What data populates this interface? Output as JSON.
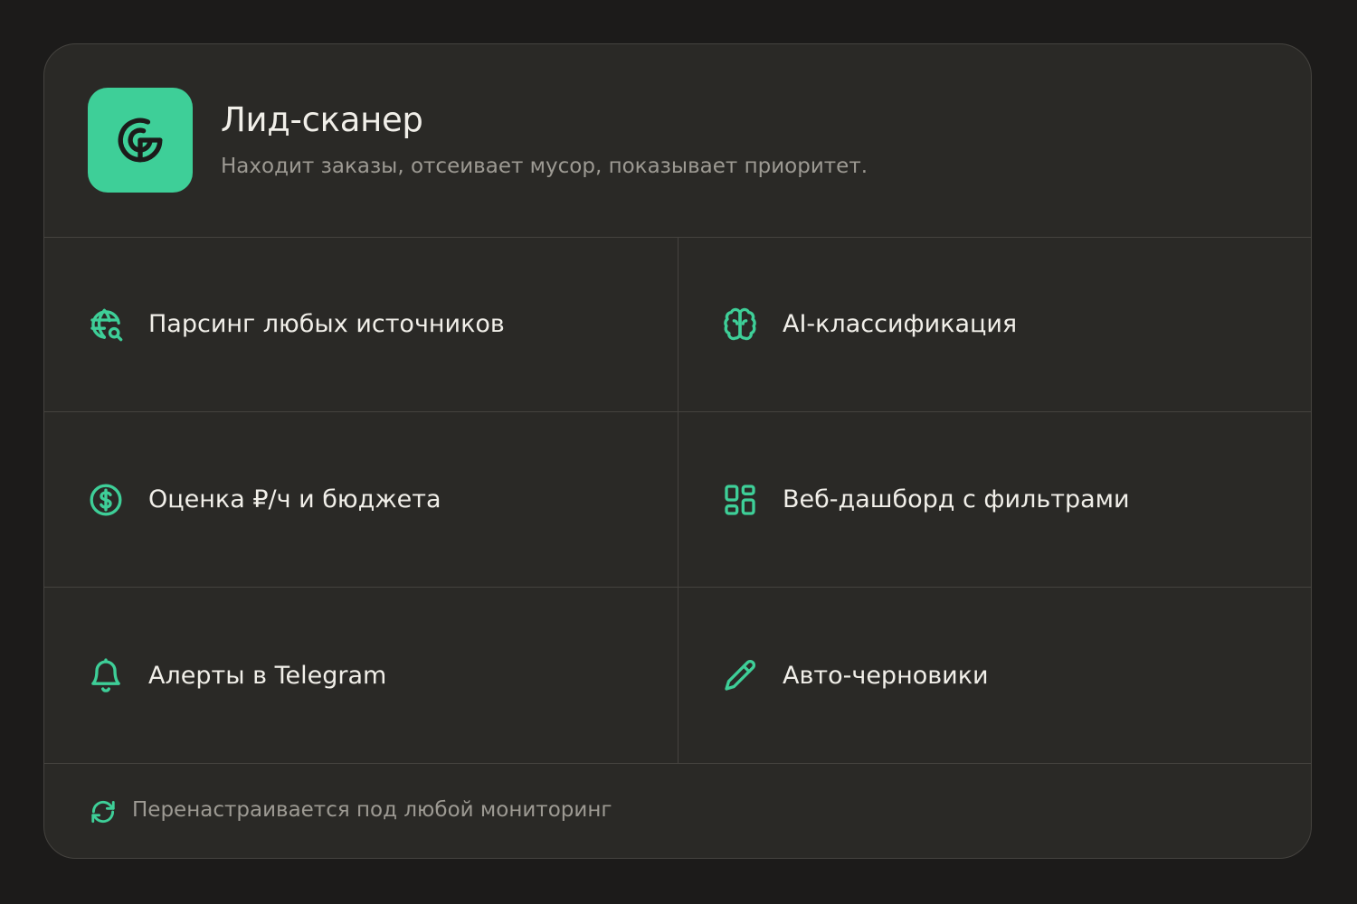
{
  "app": {
    "title": "Лид-сканер",
    "subtitle": "Находит заказы, отсеивает мусор, показывает приоритет.",
    "logo_icon": "radar-scan-icon"
  },
  "features": [
    {
      "label": "Парсинг любых источников",
      "icon": "globe-search-icon"
    },
    {
      "label": "AI-классификация",
      "icon": "brain-icon"
    },
    {
      "label": "Оценка ₽/ч и бюджета",
      "icon": "dollar-circle-icon"
    },
    {
      "label": "Веб-дашборд с фильтрами",
      "icon": "dashboard-icon"
    },
    {
      "label": "Алерты в Telegram",
      "icon": "bell-icon"
    },
    {
      "label": "Авто-черновики",
      "icon": "pencil-icon"
    }
  ],
  "footer": {
    "text": "Перенастраивается под любой мониторинг",
    "icon": "refresh-icon"
  },
  "colors": {
    "accent": "#3ecf98",
    "background": "#1c1b1a",
    "card": "#2a2926",
    "border": "#45433f",
    "text": "#f1efe9",
    "muted": "#9d9a93"
  }
}
